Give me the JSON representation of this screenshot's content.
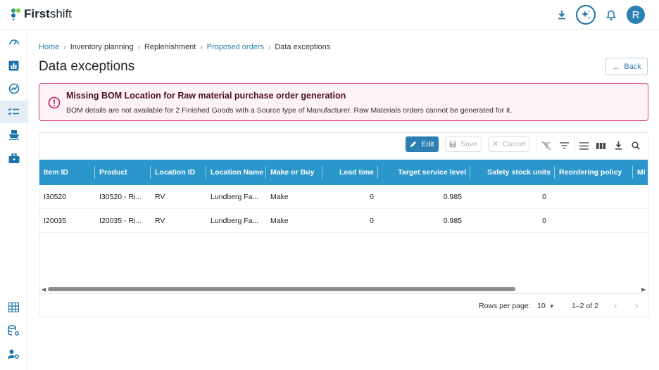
{
  "app": {
    "brand_bold": "First",
    "brand_rest": "shift",
    "avatar_initial": "R",
    "accent_color": "#2b7fb3",
    "table_header_color": "#2b96c9"
  },
  "topbar": {
    "icons": [
      "download-icon",
      "ai-sparkle-icon",
      "bell-icon",
      "avatar"
    ]
  },
  "sidebar": {
    "items": [
      {
        "icon": "speedometer-icon"
      },
      {
        "icon": "bar-chart-icon"
      },
      {
        "icon": "trend-gauge-icon"
      },
      {
        "icon": "checklist-icon",
        "active": true
      },
      {
        "icon": "ship-icon"
      },
      {
        "icon": "briefcase-icon"
      },
      {
        "icon": "warehouse-grid-icon"
      },
      {
        "icon": "database-settings-icon"
      },
      {
        "icon": "user-settings-icon"
      }
    ]
  },
  "breadcrumb": {
    "items": [
      "Home",
      "Inventory planning",
      "Replenishment",
      "Proposed orders",
      "Data exceptions"
    ]
  },
  "page": {
    "title": "Data exceptions",
    "back_label": "Back"
  },
  "alert": {
    "title": "Missing BOM Location for Raw material purchase order generation",
    "body": "BOM details are not available for 2 Finished Goods with a Source type of Manufacturer. Raw Materials orders cannot be generated for it."
  },
  "toolbar": {
    "edit_label": "Edit",
    "save_label": "Save",
    "cancel_label": "Cancel"
  },
  "table": {
    "columns": [
      "Item ID",
      "Product",
      "Location ID",
      "Location Name",
      "Make or Buy",
      "Lead time",
      "Target service level",
      "Safety stock units",
      "Reordering policy",
      "Mi"
    ],
    "rows": [
      [
        "I30520",
        "I30520 - Ri...",
        "RV",
        "Lundberg Fa...",
        "Make",
        "0",
        "0.985",
        "0",
        ""
      ],
      [
        "I20035",
        "I20035 - Ri...",
        "RV",
        "Lundberg Fa...",
        "Make",
        "0",
        "0.985",
        "0",
        ""
      ]
    ]
  },
  "pagination": {
    "rows_per_page_label": "Rows per page:",
    "rows_per_page_value": "10",
    "range": "1–2 of 2"
  }
}
